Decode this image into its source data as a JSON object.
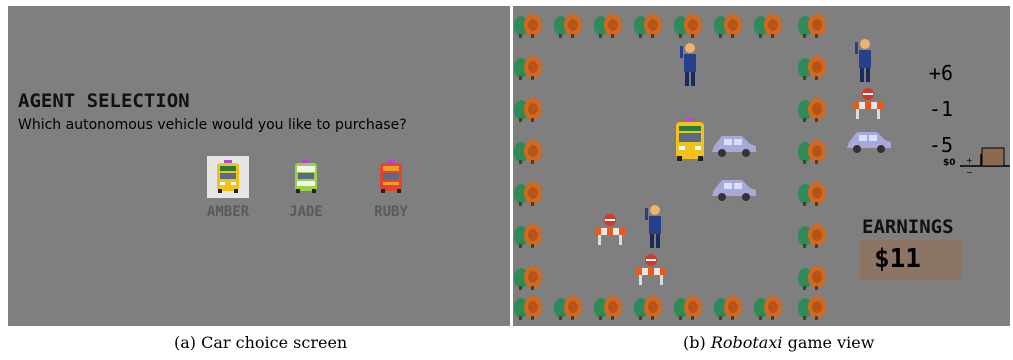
{
  "panel_a": {
    "title": "AGENT SELECTION",
    "question": "Which autonomous vehicle would you like to purchase?",
    "vehicles": [
      {
        "label": "AMBER",
        "color": "#f2c21a",
        "selected": true
      },
      {
        "label": "JADE",
        "color": "#9ad04a",
        "selected": false
      },
      {
        "label": "RUBY",
        "color": "#e0452f",
        "selected": false
      }
    ]
  },
  "panel_b": {
    "scores": [
      "+6",
      "-1",
      "-5"
    ],
    "earnings_title": "EARNINGS",
    "earnings_value": "$11",
    "scale_label": "$0"
  },
  "captions": {
    "a": "(a) Car choice screen",
    "b_prefix": "(b) ",
    "b_italic": "Robotaxi",
    "b_suffix": " game view"
  },
  "colors": {
    "panel_bg": "#7f7f7f",
    "earnings_box": "#8c7565",
    "taxi_yellow": "#f2c21a",
    "sedan_lilac": "#a9a9d9",
    "tree_green": "#2e8b57",
    "tree_orange": "#d2691e"
  },
  "icons": {
    "tree": "tree-icon",
    "taxi": "robotaxi-icon",
    "sedan": "sedan-car-icon",
    "pedestrian": "pedestrian-icon",
    "roadblock": "roadblock-icon"
  }
}
